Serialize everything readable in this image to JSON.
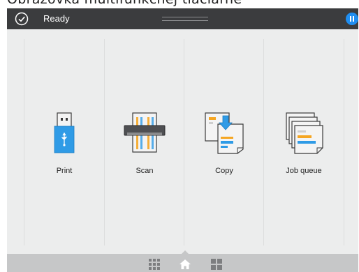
{
  "caption": "Obrazovka multifunkčnej tlačiarne",
  "status": {
    "text": "Ready",
    "pause_label": "II"
  },
  "tiles": [
    {
      "label": "Print",
      "icon": "usb-drive-icon"
    },
    {
      "label": "Scan",
      "icon": "scanner-icon"
    },
    {
      "label": "Copy",
      "icon": "copy-icon"
    },
    {
      "label": "Job queue",
      "icon": "job-queue-icon"
    }
  ],
  "nav": {
    "left": "apps-grid-icon",
    "center": "home-icon",
    "right": "widgets-icon"
  },
  "colors": {
    "statusbar": "#3b3c3e",
    "accent": "#1f8ef1",
    "panel": "#eceded",
    "bottombar": "#c6c7c8",
    "orange": "#f5a623"
  }
}
